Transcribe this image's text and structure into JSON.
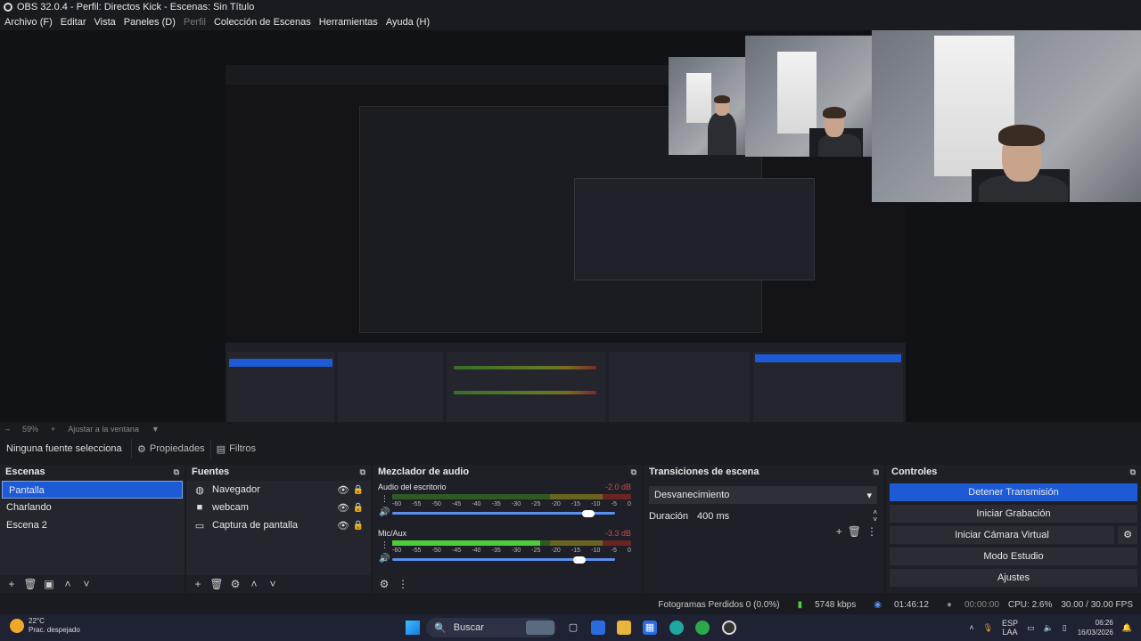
{
  "window": {
    "title": "OBS 32.0.4 - Perfil: Directos Kick - Escenas: Sin Título"
  },
  "menu": [
    "Archivo (F)",
    "Editar",
    "Vista",
    "Paneles (D)",
    "Perfil",
    "Colección de Escenas",
    "Herramientas",
    "Ayuda (H)"
  ],
  "zoom": {
    "minus": "–",
    "value": "59%",
    "plus": "+",
    "fit_label": "Ajustar a la ventana",
    "dropdown": "▼"
  },
  "context": {
    "no_source": "Ninguna fuente selecciona",
    "properties": "Propiedades",
    "filters": "Filtros"
  },
  "scenes": {
    "title": "Escenas",
    "items": [
      "Pantalla",
      "Charlando",
      "Escena 2"
    ],
    "selected": 0
  },
  "sources": {
    "title": "Fuentes",
    "items": [
      {
        "name": "Navegador",
        "icon": "globe-icon"
      },
      {
        "name": "webcam",
        "icon": "camera-icon"
      },
      {
        "name": "Captura de pantalla",
        "icon": "monitor-icon"
      }
    ]
  },
  "mixer": {
    "title": "Mezclador de audio",
    "channels": [
      {
        "name": "Audio del escritorio",
        "db": "-2.0 dB",
        "level": 0.0,
        "volume": 0.88
      },
      {
        "name": "Mic/Aux",
        "db": "-3.3 dB",
        "level": 0.62,
        "volume": 0.84
      }
    ],
    "ticks": [
      "-60",
      "-55",
      "-50",
      "-45",
      "-40",
      "-35",
      "-30",
      "-25",
      "-20",
      "-15",
      "-10",
      "-5",
      "0"
    ]
  },
  "transitions": {
    "title": "Transiciones de escena",
    "selected": "Desvanecimiento",
    "duration_label": "Duración",
    "duration_value": "400 ms"
  },
  "controls": {
    "title": "Controles",
    "buttons": [
      "Detener Transmisión",
      "Iniciar Grabación",
      "Iniciar Cámara Virtual",
      "Modo Estudio",
      "Ajustes"
    ]
  },
  "status": {
    "dropped": "Fotogramas Perdidos 0 (0.0%)",
    "bitrate": "5748 kbps",
    "stream_time": "01:46:12",
    "rec_time": "00:00:00",
    "cpu": "CPU: 2.6%",
    "fps": "30.00 / 30.00 FPS"
  },
  "taskbar": {
    "temp": "22°C",
    "weather": "Prac. despejado",
    "search": "Buscar",
    "lang_1": "ESP",
    "lang_2": "LAA",
    "time": "06:26",
    "date": "16/03/2026"
  },
  "colors": {
    "accent": "#1d5bd6",
    "panel": "#25262d",
    "background": "#1a1b21",
    "meter_green": "#4ccd3a"
  }
}
